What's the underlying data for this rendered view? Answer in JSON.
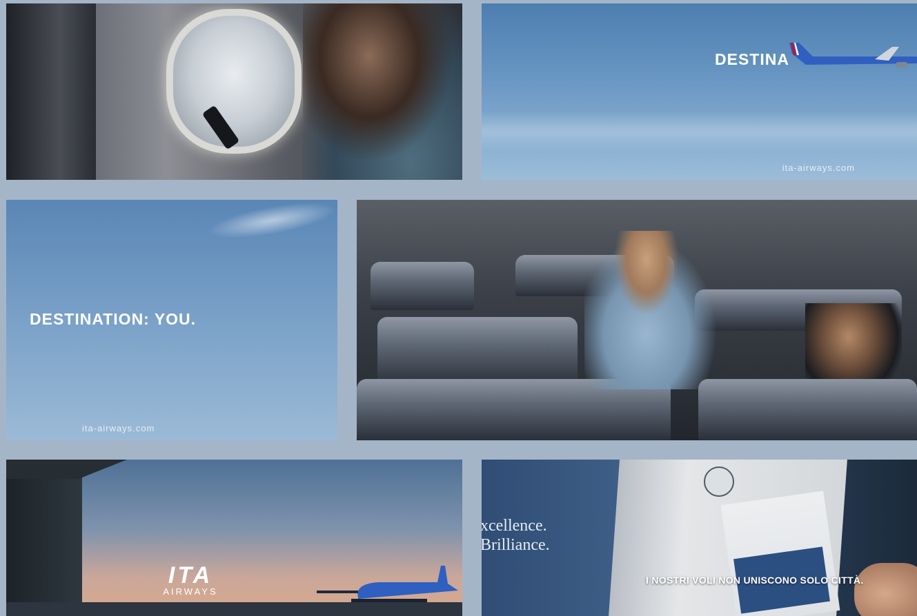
{
  "tiles": {
    "top_right": {
      "headline": "DESTINA",
      "url": "ita-airways.com"
    },
    "middle_left": {
      "headline": "DESTINATION: YOU.",
      "url": "ita-airways.com"
    },
    "bottom_left": {
      "logo_mark": "ITA",
      "logo_sub": "AIRWAYS"
    },
    "bottom_right": {
      "brochure_line1": "xcellence.",
      "brochure_line2": "Brilliance.",
      "caption": "I NOSTRI VOLI NON UNISCONO SOLO CITTÀ."
    }
  },
  "colors": {
    "background": "#a5b5c8",
    "sky_blue": "#6b98c4",
    "aircraft_blue": "#2f5fc0"
  }
}
